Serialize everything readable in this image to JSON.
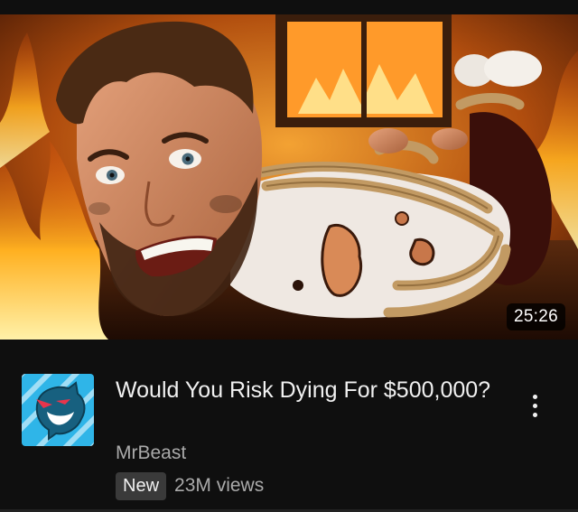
{
  "video": {
    "duration": "25:26",
    "title": "Would You Risk Dying For $500,000?",
    "channel": "MrBeast",
    "badge": "New",
    "views": "23M views"
  },
  "icons": {
    "avatar": "mrbeast-panther-logo-icon",
    "menu": "more-vertical-icon"
  },
  "colors": {
    "background": "#0f0f0f",
    "primary_text": "#f1f1f1",
    "secondary_text": "#aaaaaa",
    "badge_background": "#3a3a3a",
    "avatar_blue": "#2fb5e8"
  }
}
